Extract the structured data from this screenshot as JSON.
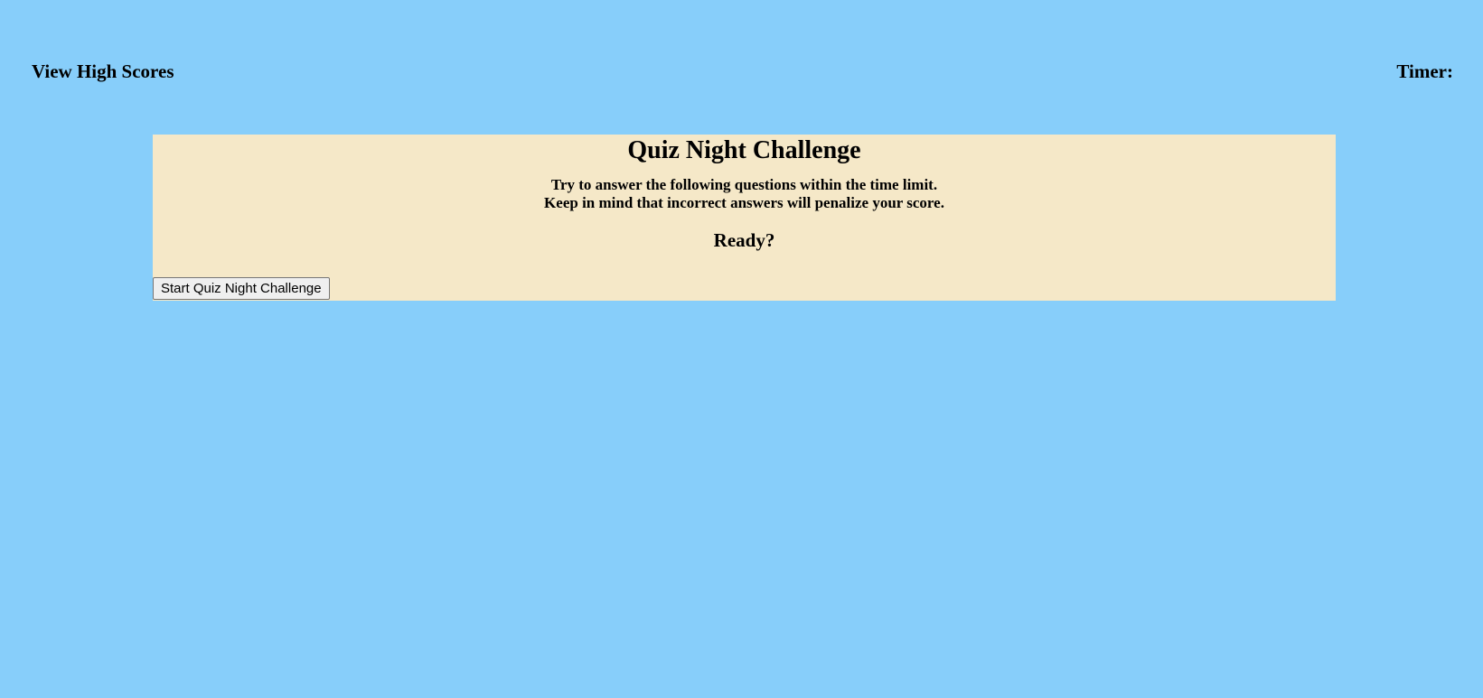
{
  "header": {
    "high_scores_label": "View High Scores",
    "timer_label": "Timer:",
    "timer_value": ""
  },
  "quiz": {
    "title": "Quiz Night Challenge",
    "instruction_line1": "Try to answer the following questions within the time limit.",
    "instruction_line2": "Keep in mind that incorrect answers will penalize your score.",
    "ready_text": "Ready?",
    "start_button_label": "Start Quiz Night Challenge"
  },
  "colors": {
    "background": "#87cefa",
    "panel": "#f5e8c8"
  }
}
